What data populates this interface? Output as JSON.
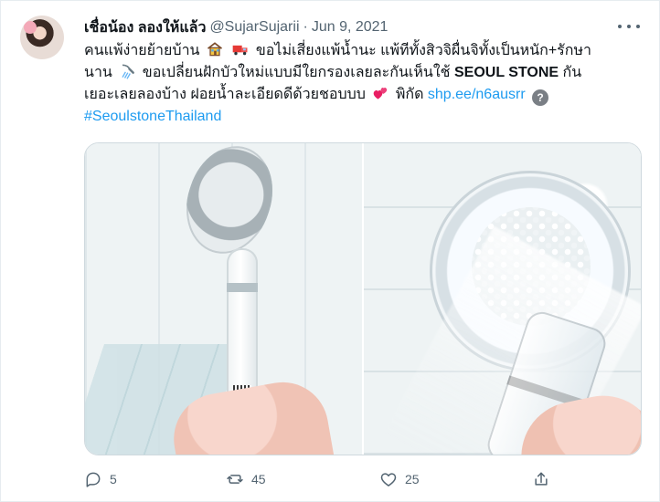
{
  "tweet": {
    "author_name": "เชื่อน้อง ลองให้แล้ว",
    "handle": "@SujarSujarii",
    "dot": "·",
    "date": "Jun 9, 2021",
    "text": {
      "line1": "คนแพ้ง่ายย้ายบ้าน",
      "line1b": "ขอไม่เสี่ยงแพ้น้ำนะ แพ้ทีทั้งสิวจิผื่นจิทั้งเป็นหนัก+รักษา",
      "line2": "นาน",
      "line2b": "ขอเปลี่ยนฝักบัวใหม่แบบมีใยกรองเลยละกันเห็นใช้",
      "brand": "SEOUL STONE",
      "line2c": "กัน",
      "line3": "เยอะเลยลองบ้าง ฝอยน้ำละเอียดดีด้วยชอบบบ",
      "line3b": "พิกัด",
      "link": "shp.ee/n6ausrr",
      "hashtag": "#SeoulstoneThailand"
    },
    "icons": {
      "more": "more-horizontal-icon",
      "reply": "reply-icon",
      "retweet": "retweet-icon",
      "like": "heart-icon",
      "share": "share-icon"
    },
    "counts": {
      "replies": "5",
      "retweets": "45",
      "likes": "25"
    }
  }
}
